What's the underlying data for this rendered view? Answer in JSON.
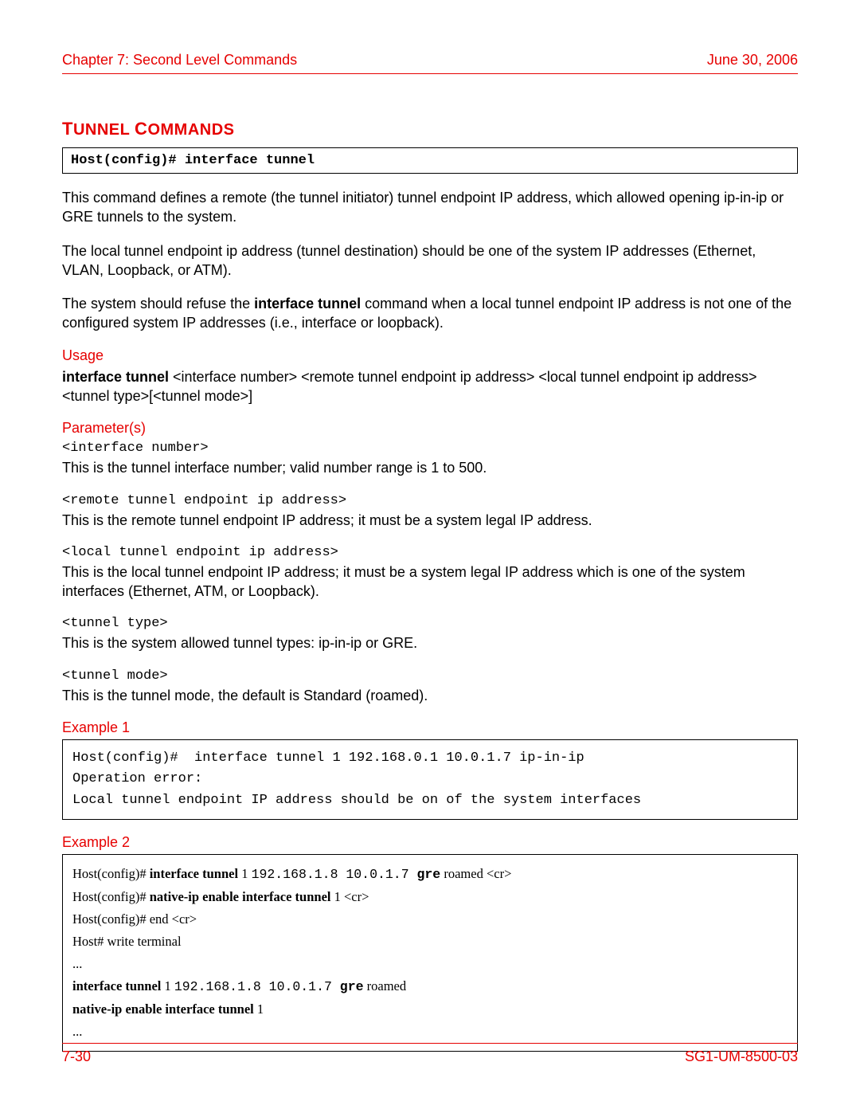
{
  "header": {
    "chapter": "Chapter 7: Second Level Commands",
    "date": "June 30, 2006"
  },
  "title": "Tunnel Commands",
  "cmd_box": "Host(config)# interface tunnel",
  "intro": {
    "p1": "This command defines a remote (the tunnel initiator) tunnel endpoint IP address, which allowed opening ip-in-ip or GRE tunnels to the system.",
    "p2": "The local tunnel endpoint ip address (tunnel destination) should be one of the system IP addresses (Ethernet, VLAN, Loopback, or ATM).",
    "p3_pre": "The system should refuse the ",
    "p3_bold": "interface tunnel",
    "p3_post": " command when a local tunnel endpoint IP address is not one of the configured system IP addresses (i.e., interface or loopback)."
  },
  "usage": {
    "heading": "Usage",
    "bold": "interface tunnel",
    "rest": " <interface number> <remote tunnel endpoint ip address> <local tunnel endpoint ip address> <tunnel type>[<tunnel mode>]"
  },
  "params": {
    "heading": "Parameter(s)",
    "items": [
      {
        "name": "<interface number>",
        "desc": "This is the tunnel interface number; valid number range is 1 to 500."
      },
      {
        "name": "<remote tunnel endpoint ip address>",
        "desc": "This is the remote tunnel endpoint IP address; it must be a system legal IP address."
      },
      {
        "name": "<local tunnel endpoint ip address>",
        "desc": "This is the local tunnel endpoint IP address; it must be a system legal IP address which is one of the system interfaces (Ethernet, ATM, or Loopback)."
      },
      {
        "name": "<tunnel type>",
        "desc": "This is the system allowed tunnel types: ip-in-ip or GRE."
      },
      {
        "name": "<tunnel mode>",
        "desc": "This is the tunnel mode, the default is Standard (roamed)."
      }
    ]
  },
  "example1": {
    "heading": "Example 1",
    "text": "Host(config)#  interface tunnel 1 192.168.0.1 10.0.1.7 ip-in-ip\nOperation error:\nLocal tunnel endpoint IP address should be on of the system interfaces"
  },
  "example2": {
    "heading": "Example 2",
    "l1_a": "Host(config)# ",
    "l1_b": "interface tunnel",
    "l1_c": " 1 ",
    "l1_m": "192.168.1.8 10.0.1.7  ",
    "l1_d": "gre",
    "l1_e": " roamed <cr>",
    "l2_a": "Host(config)# ",
    "l2_b": "native-ip enable interface tunnel",
    "l2_c": " 1 <cr>",
    "l3": "Host(config)# end <cr>",
    "l4": "Host# write terminal",
    "l5": "...",
    "l6_a": "interface tunnel",
    "l6_b": " 1 ",
    "l6_m": "192.168.1.8 10.0.1.7 ",
    "l6_c": "gre",
    "l6_d": " roamed",
    "l7_a": "native-ip enable interface tunnel",
    "l7_b": " 1",
    "l8": "..."
  },
  "footer": {
    "page": "7-30",
    "doc": "SG1-UM-8500-03"
  }
}
